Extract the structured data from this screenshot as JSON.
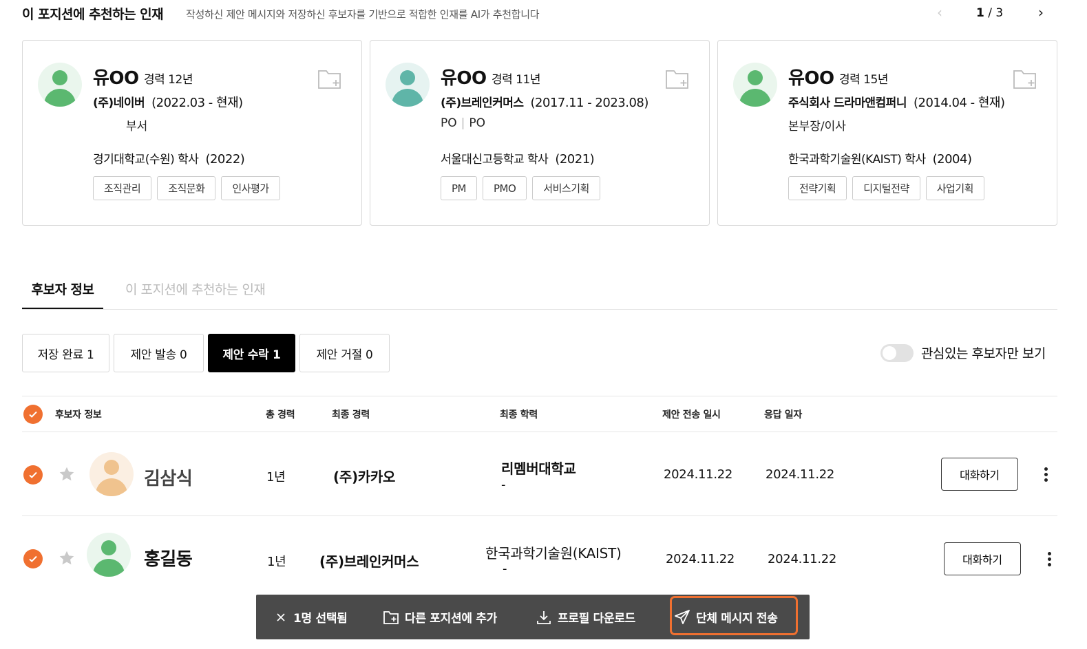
{
  "recommend": {
    "title": "이 포지션에 추천하는 인재",
    "subtitle": "작성하신 제안 메시지와 저장하신 후보자를 기반으로 적합한 인재를 AI가 추천합니다",
    "pager": {
      "prev": "‹",
      "current": "1",
      "total": " / 3",
      "next": "›"
    },
    "cards": [
      {
        "name": "유OO",
        "experience": "경력 12년",
        "company": "(주)네이버",
        "period": "(2022.03 - 현재)",
        "dept": "부서",
        "education": "경기대학교(수원) 학사",
        "edu_year": "(2022)",
        "tags": [
          "조직관리",
          "조직문화",
          "인사평가"
        ],
        "avatar_color": "#5bb870"
      },
      {
        "name": "유OO",
        "experience": "경력 11년",
        "company": "(주)브레인커머스",
        "period": "(2017.11 - 2023.08)",
        "dept": "PO",
        "dept2": "PO",
        "education": "서울대신고등학교 학사",
        "edu_year": "(2021)",
        "tags": [
          "PM",
          "PMO",
          "서비스기획"
        ],
        "avatar_color": "#5fb5a8"
      },
      {
        "name": "유OO",
        "experience": "경력 15년",
        "company": "주식회사 드라마앤컴퍼니",
        "period": "(2014.04 - 현재)",
        "dept": "본부장/이사",
        "education": "한국과학기술원(KAIST) 학사",
        "edu_year": "(2004)",
        "tags": [
          "전략기획",
          "디지털전략",
          "사업기획"
        ],
        "avatar_color": "#5bb870"
      }
    ]
  },
  "tabs": {
    "candidate_info": "후보자 정보",
    "recommended": "이 포지션에 추천하는 인재"
  },
  "filters": [
    {
      "label": "저장 완료 1"
    },
    {
      "label": "제안 발송 0"
    },
    {
      "label": "제안 수락 1"
    },
    {
      "label": "제안 거절 0"
    }
  ],
  "toggle": {
    "label": "관심있는 후보자만 보기"
  },
  "table": {
    "headers": {
      "candidate": "후보자 정보",
      "total_exp": "총 경력",
      "last_career": "최종 경력",
      "last_edu": "최종 학력",
      "sent_date": "제안 전송 일시",
      "reply_date": "응답 일자"
    },
    "rows": [
      {
        "name": "김삼식",
        "total_exp": "1년",
        "last_career": "(주)카카오",
        "last_edu": "리멤버대학교",
        "edu_sub": "-",
        "sent_date": "2024.11.22",
        "reply_date": "2024.11.22",
        "chat": "대화하기",
        "avatar_color": "#f0c38e"
      },
      {
        "name": "홍길동",
        "total_exp": "1년",
        "last_career": "(주)브레인커머스",
        "last_edu": "한국과학기술원(KAIST)",
        "edu_sub": "-",
        "sent_date": "2024.11.22",
        "reply_date": "2024.11.22",
        "chat": "대화하기",
        "avatar_color": "#5bb870"
      }
    ]
  },
  "actionbar": {
    "selected": "1명 선택됨",
    "add_to_position": "다른 포지션에 추가",
    "download_profile": "프로필 다운로드",
    "group_message": "단체 메시지 전송"
  },
  "colors": {
    "accent": "#f07030",
    "bar_bg": "#4a4a4a"
  }
}
